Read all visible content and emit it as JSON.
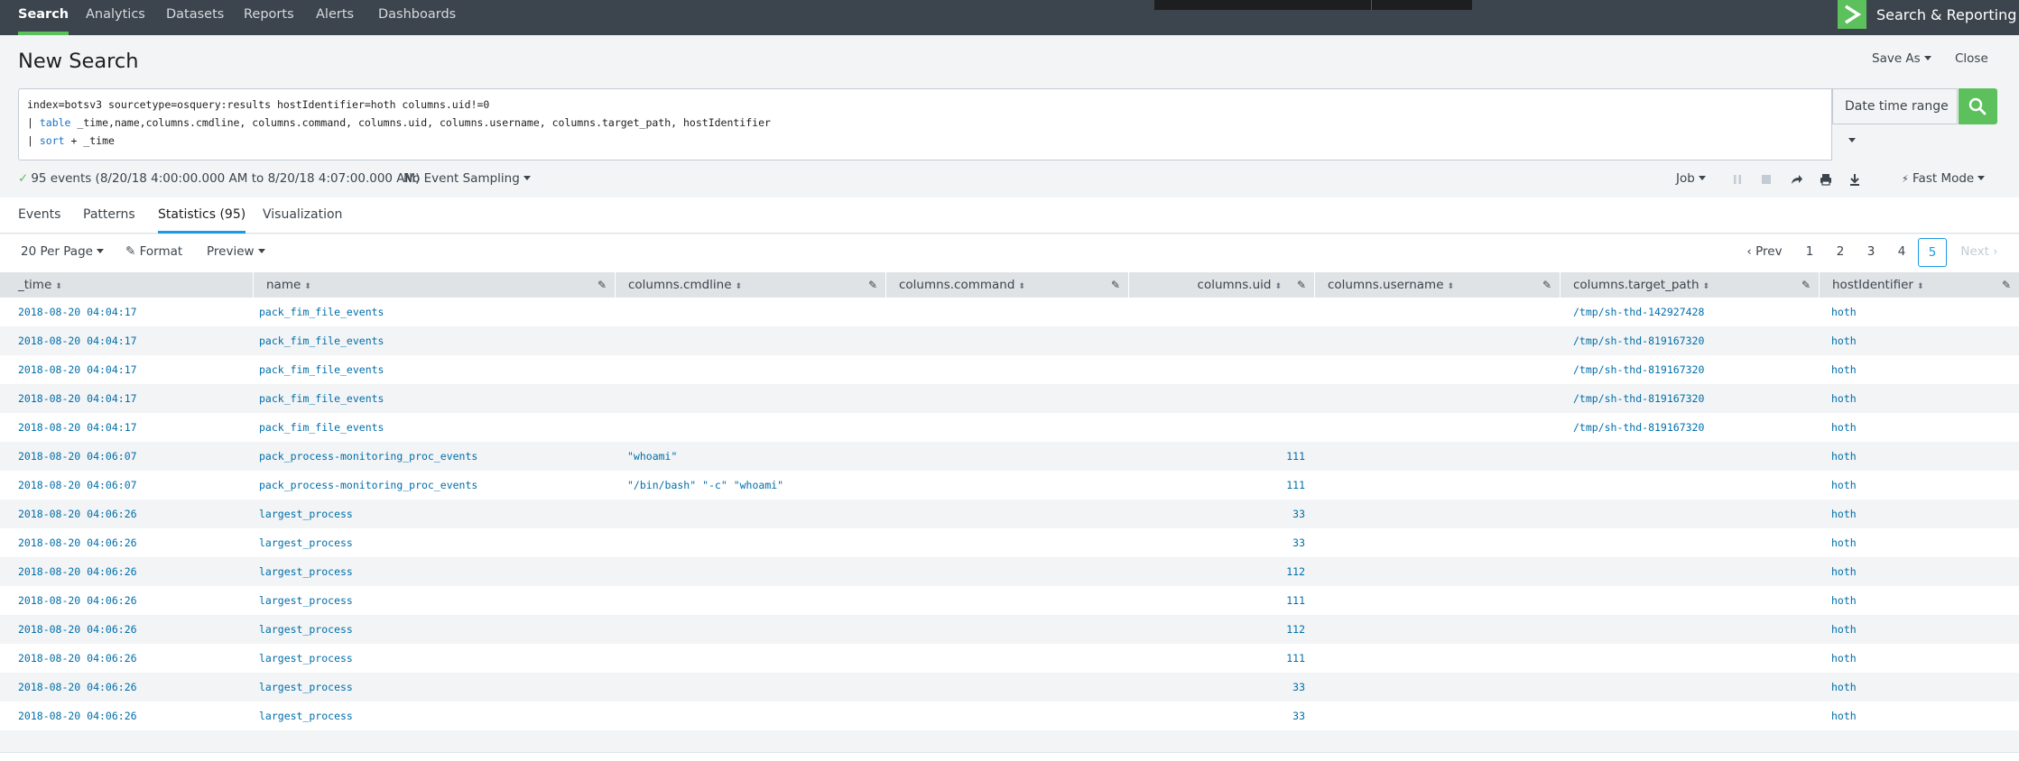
{
  "nav": {
    "items": [
      "Search",
      "Analytics",
      "Datasets",
      "Reports",
      "Alerts",
      "Dashboards"
    ],
    "app_name": "Search & Reporting",
    "accent": "#5cc05c"
  },
  "header": {
    "title": "New Search",
    "save_as": "Save As",
    "close": "Close"
  },
  "search": {
    "line1": "index=botsv3 sourcetype=osquery:results hostIdentifier=hoth columns.uid!=0",
    "line2_pipe": "| ",
    "line2_cmd": "table",
    "line2_rest": " _time,name,columns.cmdline, columns.command, columns.uid, columns.username, columns.target_path, hostIdentifier",
    "line3_pipe": "| ",
    "line3_cmd": "sort",
    "line3_rest": " + _time",
    "time_range": "Date time range",
    "search_icon": "search-icon"
  },
  "status": {
    "events": "95 events (8/20/18 4:00:00.000 AM to 8/20/18 4:07:00.000 AM)",
    "sampling": "No Event Sampling",
    "job": "Job",
    "mode": "Fast Mode"
  },
  "tabs": [
    "Events",
    "Patterns",
    "Statistics (95)",
    "Visualization"
  ],
  "toolbar": {
    "per_page": "20 Per Page",
    "format": "Format",
    "preview": "Preview",
    "prev": "Prev",
    "pages": [
      "1",
      "2",
      "3",
      "4",
      "5"
    ],
    "current_page": "5",
    "next": "Next"
  },
  "table": {
    "columns": [
      "_time",
      "name",
      "columns.cmdline",
      "columns.command",
      "columns.uid",
      "columns.username",
      "columns.target_path",
      "hostIdentifier"
    ],
    "rows": [
      [
        "2018-08-20 04:04:17",
        "pack_fim_file_events",
        "",
        "",
        "",
        "",
        "/tmp/sh-thd-142927428",
        "hoth"
      ],
      [
        "2018-08-20 04:04:17",
        "pack_fim_file_events",
        "",
        "",
        "",
        "",
        "/tmp/sh-thd-819167320",
        "hoth"
      ],
      [
        "2018-08-20 04:04:17",
        "pack_fim_file_events",
        "",
        "",
        "",
        "",
        "/tmp/sh-thd-819167320",
        "hoth"
      ],
      [
        "2018-08-20 04:04:17",
        "pack_fim_file_events",
        "",
        "",
        "",
        "",
        "/tmp/sh-thd-819167320",
        "hoth"
      ],
      [
        "2018-08-20 04:04:17",
        "pack_fim_file_events",
        "",
        "",
        "",
        "",
        "/tmp/sh-thd-819167320",
        "hoth"
      ],
      [
        "2018-08-20 04:06:07",
        "pack_process-monitoring_proc_events",
        "\"whoami\"",
        "",
        "111",
        "",
        "",
        "hoth"
      ],
      [
        "2018-08-20 04:06:07",
        "pack_process-monitoring_proc_events",
        "\"/bin/bash\" \"-c\" \"whoami\"",
        "",
        "111",
        "",
        "",
        "hoth"
      ],
      [
        "2018-08-20 04:06:26",
        "largest_process",
        "",
        "",
        "33",
        "",
        "",
        "hoth"
      ],
      [
        "2018-08-20 04:06:26",
        "largest_process",
        "",
        "",
        "33",
        "",
        "",
        "hoth"
      ],
      [
        "2018-08-20 04:06:26",
        "largest_process",
        "",
        "",
        "112",
        "",
        "",
        "hoth"
      ],
      [
        "2018-08-20 04:06:26",
        "largest_process",
        "",
        "",
        "111",
        "",
        "",
        "hoth"
      ],
      [
        "2018-08-20 04:06:26",
        "largest_process",
        "",
        "",
        "112",
        "",
        "",
        "hoth"
      ],
      [
        "2018-08-20 04:06:26",
        "largest_process",
        "",
        "",
        "111",
        "",
        "",
        "hoth"
      ],
      [
        "2018-08-20 04:06:26",
        "largest_process",
        "",
        "",
        "33",
        "",
        "",
        "hoth"
      ],
      [
        "2018-08-20 04:06:26",
        "largest_process",
        "",
        "",
        "33",
        "",
        "",
        "hoth"
      ]
    ]
  }
}
